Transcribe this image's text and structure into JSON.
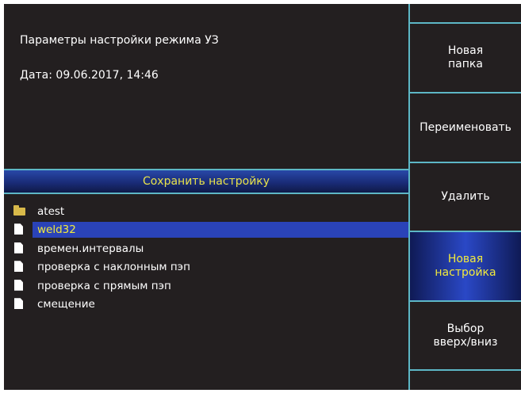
{
  "info": {
    "title": "Параметры настройки режима УЗ",
    "date": "Дата: 09.06.2017, 14:46"
  },
  "banner": {
    "label": "Сохранить настройку"
  },
  "files": [
    {
      "icon": "folder-icon",
      "name": "atest",
      "selected": false
    },
    {
      "icon": "document-icon",
      "name": "weld32",
      "selected": true
    },
    {
      "icon": "document-icon",
      "name": "времен.интервалы",
      "selected": false
    },
    {
      "icon": "document-icon",
      "name": "проверка с наклонным пэп",
      "selected": false
    },
    {
      "icon": "document-icon",
      "name": "проверка с прямым пэп",
      "selected": false
    },
    {
      "icon": "document-icon",
      "name": "смещение",
      "selected": false
    }
  ],
  "softkeys": {
    "blank_top": "",
    "new_folder": "Новая\nпапка",
    "rename": "Переименовать",
    "delete": "Удалить",
    "new_setting": "Новая\nнастройка",
    "select_up_down": "Выбор\nвверх/вниз",
    "blank_bottom": ""
  },
  "colors": {
    "background": "#231f20",
    "accent_border": "#5db7c6",
    "selection": "#2a43b8",
    "highlight_text": "#f2ea3c"
  }
}
